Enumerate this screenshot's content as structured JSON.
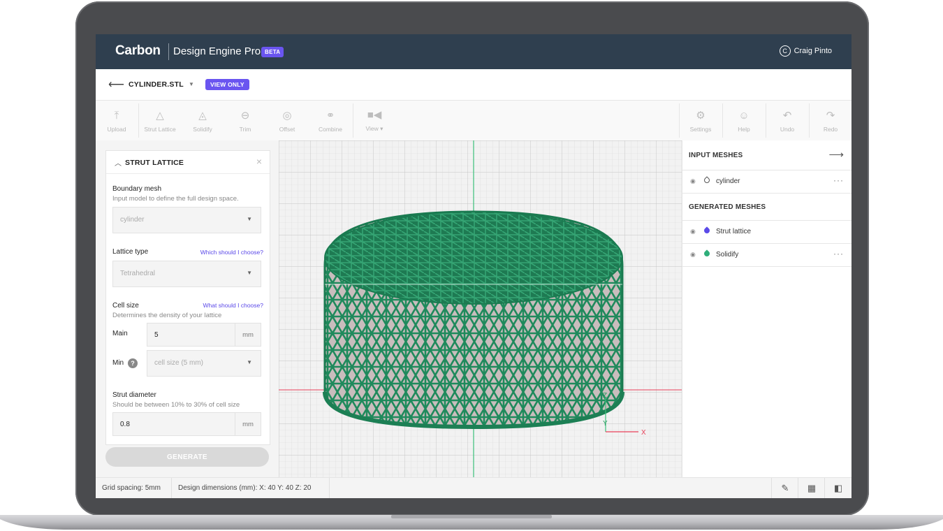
{
  "header": {
    "logo": "Carbon",
    "product": "Design Engine Pro",
    "badge": "BETA",
    "user_initial": "C",
    "user_name": "Craig Pinto"
  },
  "file_bar": {
    "file_name": "CYLINDER.STL",
    "badge": "VIEW ONLY"
  },
  "toolbar": {
    "left_tools": [
      {
        "label": "Upload",
        "icon": "upload-icon"
      },
      {
        "label": "Strut Lattice",
        "icon": "strut-lattice-icon"
      },
      {
        "label": "Solidify",
        "icon": "solidify-icon"
      },
      {
        "label": "Trim",
        "icon": "trim-icon"
      },
      {
        "label": "Offset",
        "icon": "offset-icon"
      },
      {
        "label": "Combine",
        "icon": "combine-icon"
      },
      {
        "label": "View",
        "icon": "video-camera-icon"
      }
    ],
    "right_tools": [
      {
        "label": "Settings",
        "icon": "gear-icon"
      },
      {
        "label": "Help",
        "icon": "help-person-icon"
      },
      {
        "label": "Undo",
        "icon": "undo-icon"
      },
      {
        "label": "Redo",
        "icon": "redo-icon"
      }
    ]
  },
  "strut_panel": {
    "title": "STRUT LATTICE",
    "boundary_label": "Boundary mesh",
    "boundary_help": "Input model to define the full design space.",
    "boundary_value": "cylinder",
    "lattice_label": "Lattice type",
    "lattice_link": "Which should I choose?",
    "lattice_value": "Tetrahedral",
    "cell_label": "Cell size",
    "cell_link": "What should I choose?",
    "cell_help": "Determines the density of your lattice",
    "main_label": "Main",
    "main_value": "5",
    "main_unit": "mm",
    "min_label": "Min",
    "min_placeholder": "cell size (5 mm)",
    "strut_label": "Strut diameter",
    "strut_help": "Should be between 10% to 30% of cell size",
    "strut_value": "0.8",
    "strut_unit": "mm",
    "generate": "GENERATE"
  },
  "viewport": {
    "axis_z": "Z",
    "axis_y": "Y",
    "axis_x": "X",
    "colors": {
      "lattice": "#1f8a5c",
      "solid": "#c8bcbc",
      "axis_x": "#e8405a",
      "axis_y": "#3cc07a"
    }
  },
  "meshes": {
    "input_title": "INPUT MESHES",
    "input_items": [
      {
        "name": "cylinder",
        "color": "#ffffff"
      }
    ],
    "generated_title": "GENERATED MESHES",
    "generated_items": [
      {
        "name": "Strut lattice",
        "color": "#5b4be8"
      },
      {
        "name": "Solidify",
        "color": "#2fae7a"
      }
    ]
  },
  "status": {
    "grid_spacing": "Grid spacing: 5mm",
    "dimensions": "Design dimensions (mm): X: 40  Y: 40  Z: 20"
  }
}
